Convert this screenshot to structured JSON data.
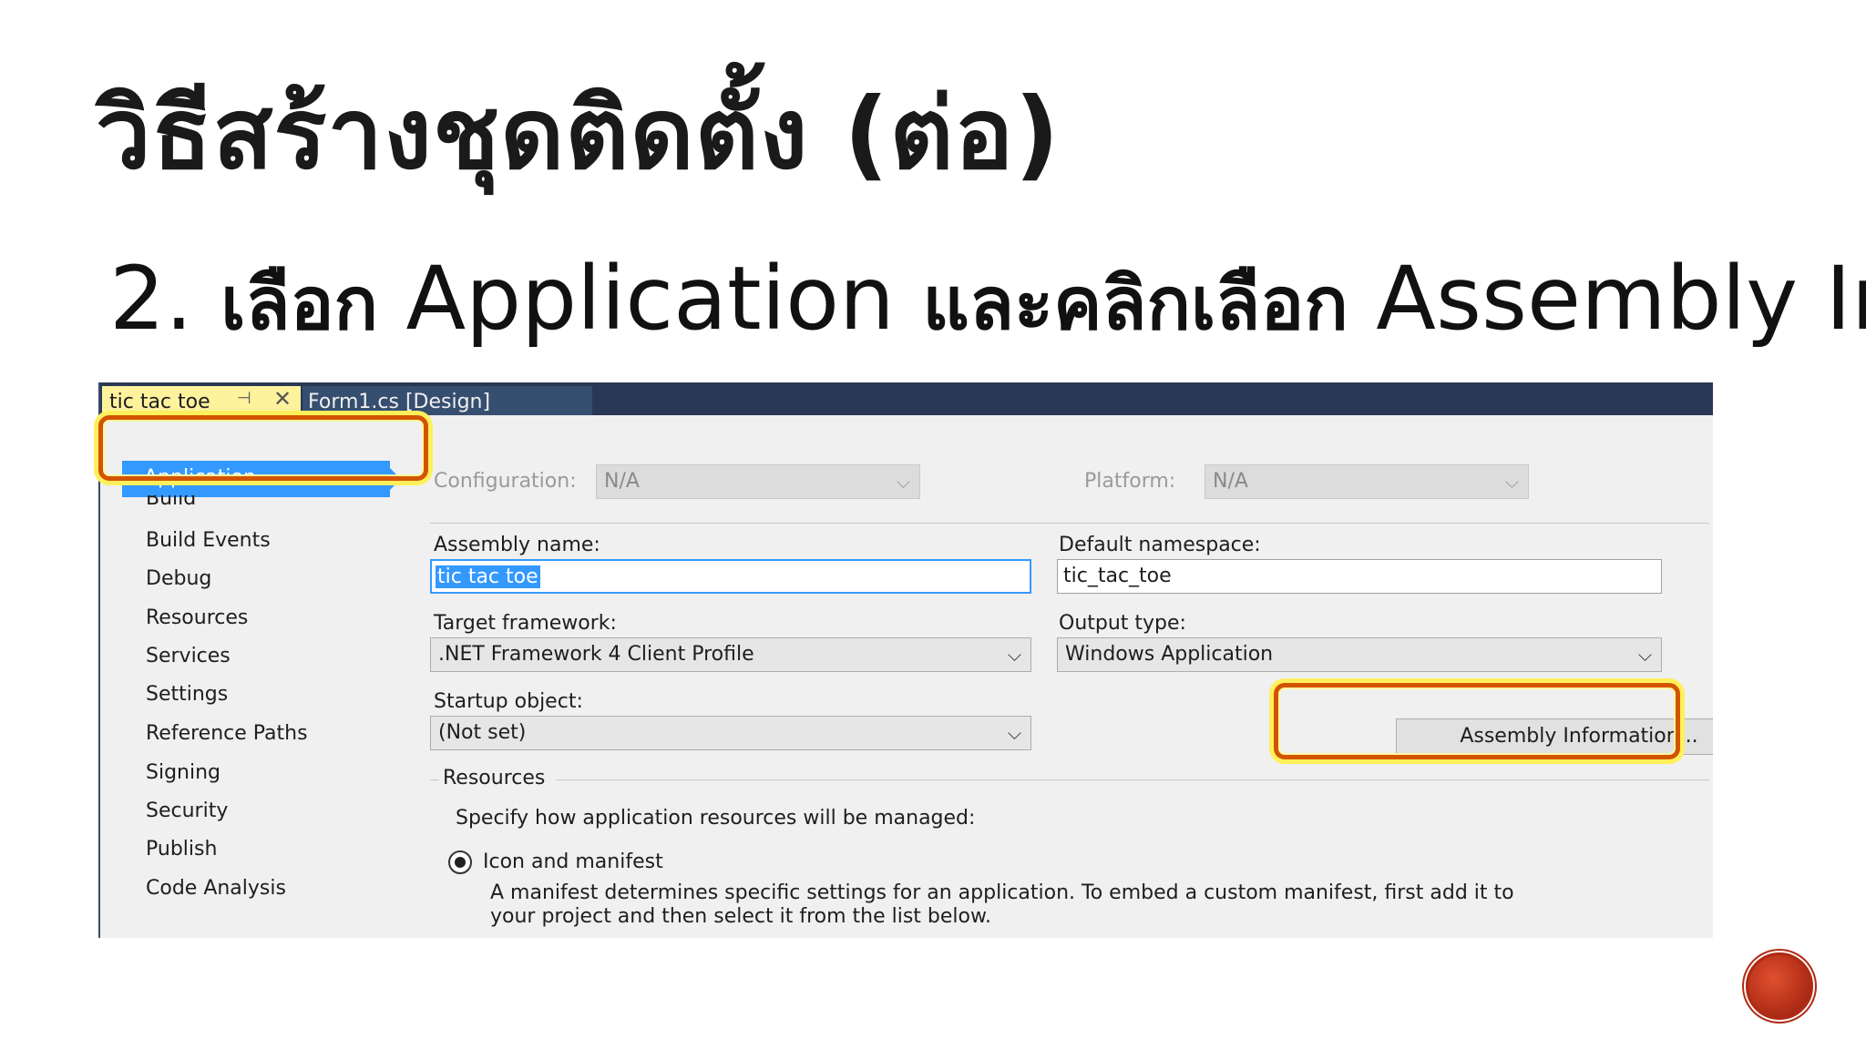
{
  "slide": {
    "title": "วิธีสร้างชุดติดตั้ง (ต่อ)",
    "bullet_number": "2.",
    "bullet_select": "เลือก",
    "bullet_app": "Application",
    "bullet_and": "และคลิกเลือก",
    "bullet_target": "Assembly Information"
  },
  "tabs": {
    "active": "tic tac toe",
    "other": "Form1.cs [Design]"
  },
  "nav": {
    "items": [
      "Application",
      "Build",
      "Build Events",
      "Debug",
      "Resources",
      "Services",
      "Settings",
      "Reference Paths",
      "Signing",
      "Security",
      "Publish",
      "Code Analysis"
    ]
  },
  "form": {
    "configuration_label": "Configuration:",
    "configuration_value": "N/A",
    "platform_label": "Platform:",
    "platform_value": "N/A",
    "assembly_name_label": "Assembly name:",
    "assembly_name_value": "tic tac toe",
    "default_namespace_label": "Default namespace:",
    "default_namespace_value": "tic_tac_toe",
    "target_framework_label": "Target framework:",
    "target_framework_value": ".NET Framework 4 Client Profile",
    "output_type_label": "Output type:",
    "output_type_value": "Windows Application",
    "startup_object_label": "Startup object:",
    "startup_object_value": "(Not set)",
    "assembly_info_button": "Assembly Information...",
    "resources_group_label": "Resources",
    "resources_desc": "Specify how application resources will be managed:",
    "radio_icon_manifest": "Icon and manifest",
    "manifest_desc_line1": "A manifest determines specific settings for an application. To embed a custom manifest, first add it to",
    "manifest_desc_line2": "your project and then select it from the list below."
  },
  "colors": {
    "highlight_border": "#d35400",
    "highlight_glow": "#fff05a",
    "selection_blue": "#3399ff",
    "tabbar": "#293955"
  }
}
